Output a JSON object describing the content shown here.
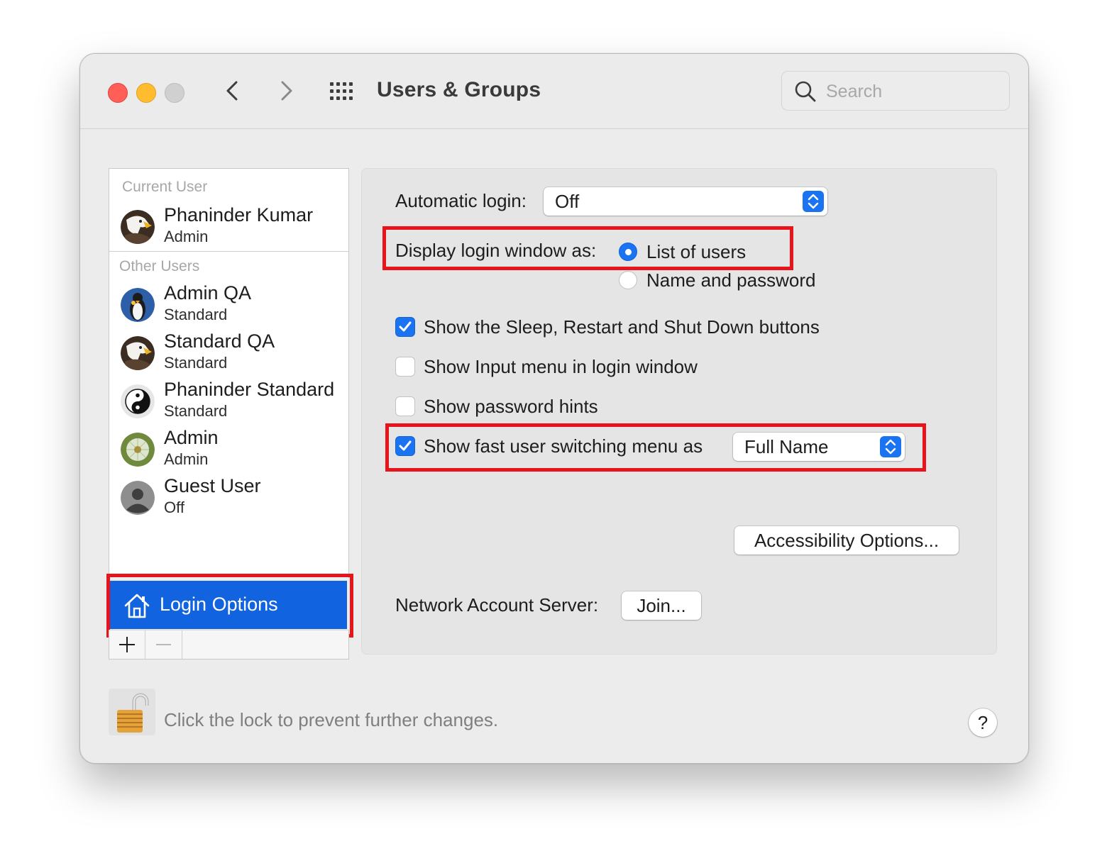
{
  "window": {
    "title": "Users & Groups"
  },
  "toolbar": {
    "back_icon": "chevron-left-icon",
    "forward_icon": "chevron-right-icon",
    "grid_icon": "grid-icon",
    "search_placeholder": "Search"
  },
  "sidebar": {
    "current_user_label": "Current User",
    "other_users_label": "Other Users",
    "current_user": {
      "name": "Phaninder Kumar",
      "role": "Admin",
      "avatar": "eagle"
    },
    "other_users": [
      {
        "name": "Admin QA",
        "role": "Standard",
        "avatar": "penguin"
      },
      {
        "name": "Standard QA",
        "role": "Standard",
        "avatar": "eagle"
      },
      {
        "name": "Phaninder Standard",
        "role": "Standard",
        "avatar": "yin-yang"
      },
      {
        "name": "Admin",
        "role": "Admin",
        "avatar": "dandelion"
      },
      {
        "name": "Guest User",
        "role": "Off",
        "avatar": "silhouette"
      }
    ],
    "login_options_label": "Login Options",
    "add_label": "+",
    "remove_label": "—"
  },
  "login": {
    "automatic_login_label": "Automatic login:",
    "automatic_login_value": "Off",
    "display_login_label": "Display login window as:",
    "display_options": [
      "List of users",
      "Name and password"
    ],
    "display_selected": "List of users",
    "checkboxes": [
      {
        "label": "Show the Sleep, Restart and Shut Down buttons",
        "checked": true
      },
      {
        "label": "Show Input menu in login window",
        "checked": false
      },
      {
        "label": "Show password hints",
        "checked": false
      },
      {
        "label": "Show fast user switching menu as",
        "checked": true
      }
    ],
    "fast_switch_value": "Full Name",
    "accessibility_button": "Accessibility Options...",
    "network_label": "Network Account Server:",
    "join_button": "Join..."
  },
  "footer": {
    "lock_text": "Click the lock to prevent further changes.",
    "help_label": "?"
  },
  "colors": {
    "accent": "#1a73f0",
    "selection": "#1263e0",
    "highlight_box": "#e8141b",
    "close": "#ff5f57",
    "minimize": "#febc2e"
  }
}
